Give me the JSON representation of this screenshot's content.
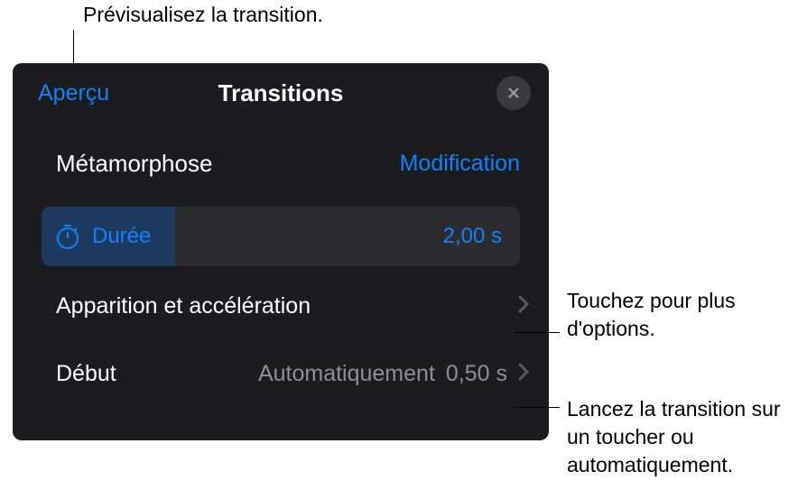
{
  "callouts": {
    "top": "Prévisualisez la transition.",
    "right1": "Touchez pour plus d'options.",
    "right2": "Lancez la transition sur un toucher ou automatiquement."
  },
  "panel": {
    "preview": "Aperçu",
    "title": "Transitions",
    "transition_name": "Métamorphose",
    "modification": "Modification",
    "duration": {
      "label": "Durée",
      "value": "2,00 s"
    },
    "appearance": {
      "label": "Apparition et accélération"
    },
    "start": {
      "label": "Début",
      "mode": "Automatiquement",
      "delay": "0,50 s"
    }
  }
}
